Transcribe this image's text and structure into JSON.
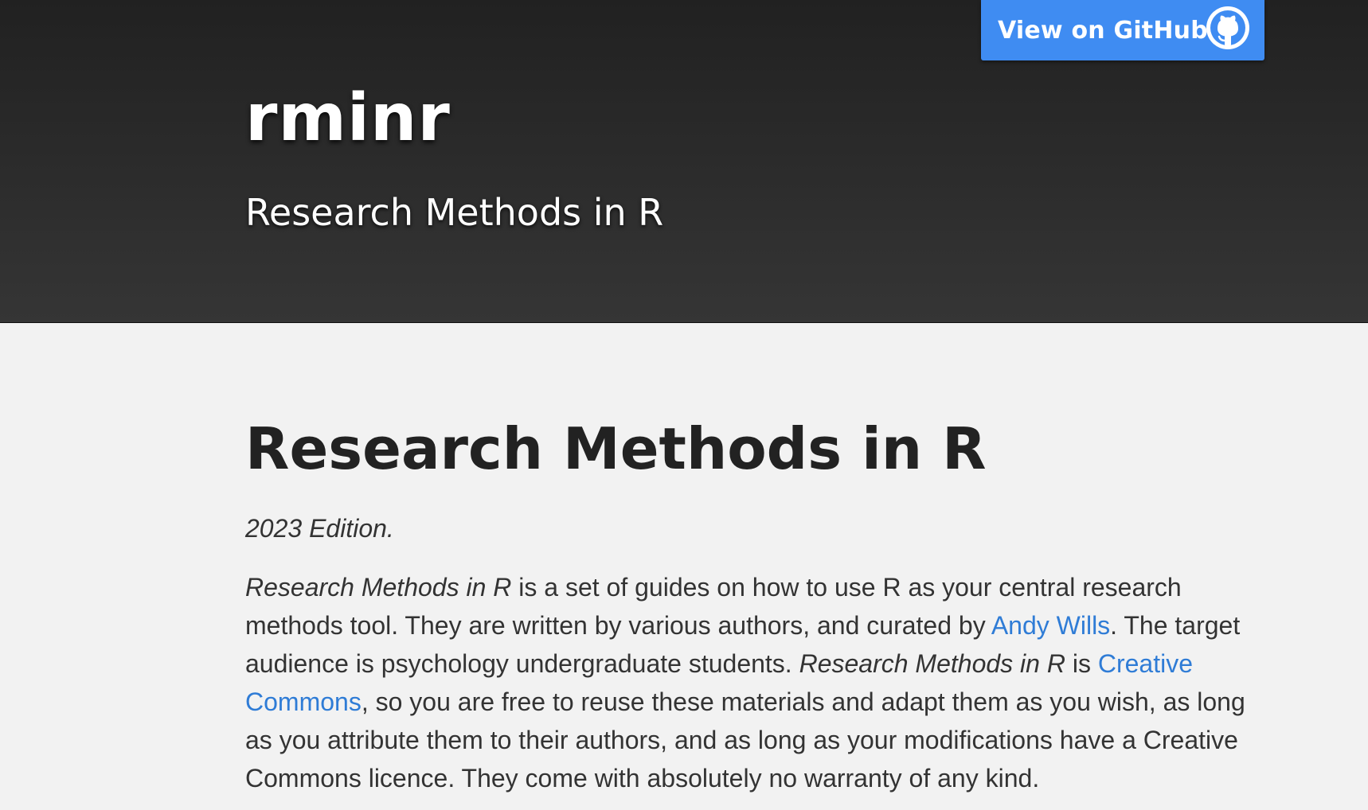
{
  "header": {
    "title": "rminr",
    "tagline": "Research Methods in R",
    "github_button": {
      "label": "View on GitHub",
      "icon": "github-octocat-icon",
      "color": "#3f8cf2"
    }
  },
  "main": {
    "heading": "Research Methods in R",
    "edition": "2023 Edition.",
    "intro": {
      "seg1_em": "Research Methods in R",
      "seg2": " is a set of guides on how to use R as your central research methods tool. They are written by various authors, and curated by ",
      "link_author": "Andy Wills",
      "seg3": ". The target audience is psychology undergraduate students. ",
      "seg4_em": "Research Methods in R",
      "seg5": " is ",
      "link_license": "Creative Commons",
      "seg6": ", so you are free to reuse these materials and adapt them as you wish, as long as you attribute them to their authors, and as long as your modifications have a Creative Commons licence. They come with absolutely no warranty of any kind."
    }
  },
  "colors": {
    "header_top": "#212121",
    "header_bottom": "#353535",
    "page_background": "#f2f2f2",
    "link": "#2f7cd6",
    "text": "#333333"
  }
}
